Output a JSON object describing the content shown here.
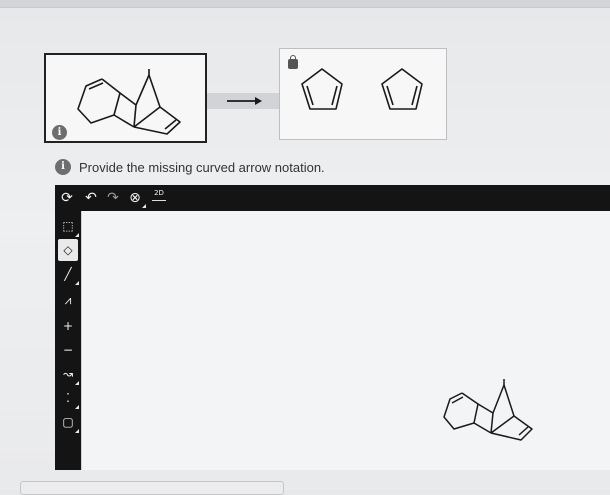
{
  "reaction": {
    "reactant_label": "dicyclopentadiene",
    "reactant_info_icon": "info-icon",
    "arrow_icon": "right-arrow-icon",
    "product_lock_icon": "lock-icon",
    "products": [
      "cyclopentadiene",
      "cyclopentadiene"
    ]
  },
  "prompt": {
    "icon": "info-icon",
    "text": "Provide the missing curved arrow notation."
  },
  "editor": {
    "top_toolbar": [
      {
        "name": "clear-tool",
        "icon": "cycle-icon",
        "glyph": "⟳"
      },
      {
        "name": "undo-tool",
        "icon": "undo-icon",
        "glyph": "↶"
      },
      {
        "name": "redo-tool",
        "icon": "redo-icon",
        "glyph": "↷"
      },
      {
        "name": "zoom-tool",
        "icon": "zoom-icon",
        "glyph": "⊗"
      },
      {
        "name": "template-tool",
        "icon": "template-icon",
        "glyph": "2D"
      }
    ],
    "side_toolbar": [
      {
        "name": "select-tool",
        "icon": "lasso-select-icon",
        "glyph": "⬚"
      },
      {
        "name": "erase-tool",
        "icon": "eraser-icon",
        "glyph": "◇"
      },
      {
        "name": "bond-tool",
        "icon": "bond-icon",
        "glyph": "╱"
      },
      {
        "name": "chain-tool",
        "icon": "chain-icon",
        "glyph": "⩘"
      },
      {
        "name": "charge-tool",
        "icon": "plus-charge-icon",
        "glyph": "+"
      },
      {
        "name": "minus-tool",
        "icon": "minus-charge-icon",
        "glyph": "−"
      },
      {
        "name": "curved-arrow-tool",
        "icon": "curved-arrow-icon",
        "glyph": "↝"
      },
      {
        "name": "lone-pair-tool",
        "icon": "lone-pair-icon",
        "glyph": "⁚"
      },
      {
        "name": "ring-tool",
        "icon": "ring-icon",
        "glyph": "▢"
      }
    ],
    "canvas_molecule": "dicyclopentadiene"
  },
  "colors": {
    "toolbar": "#141414",
    "canvas": "#f3f4f5",
    "background": "#eceef0"
  }
}
